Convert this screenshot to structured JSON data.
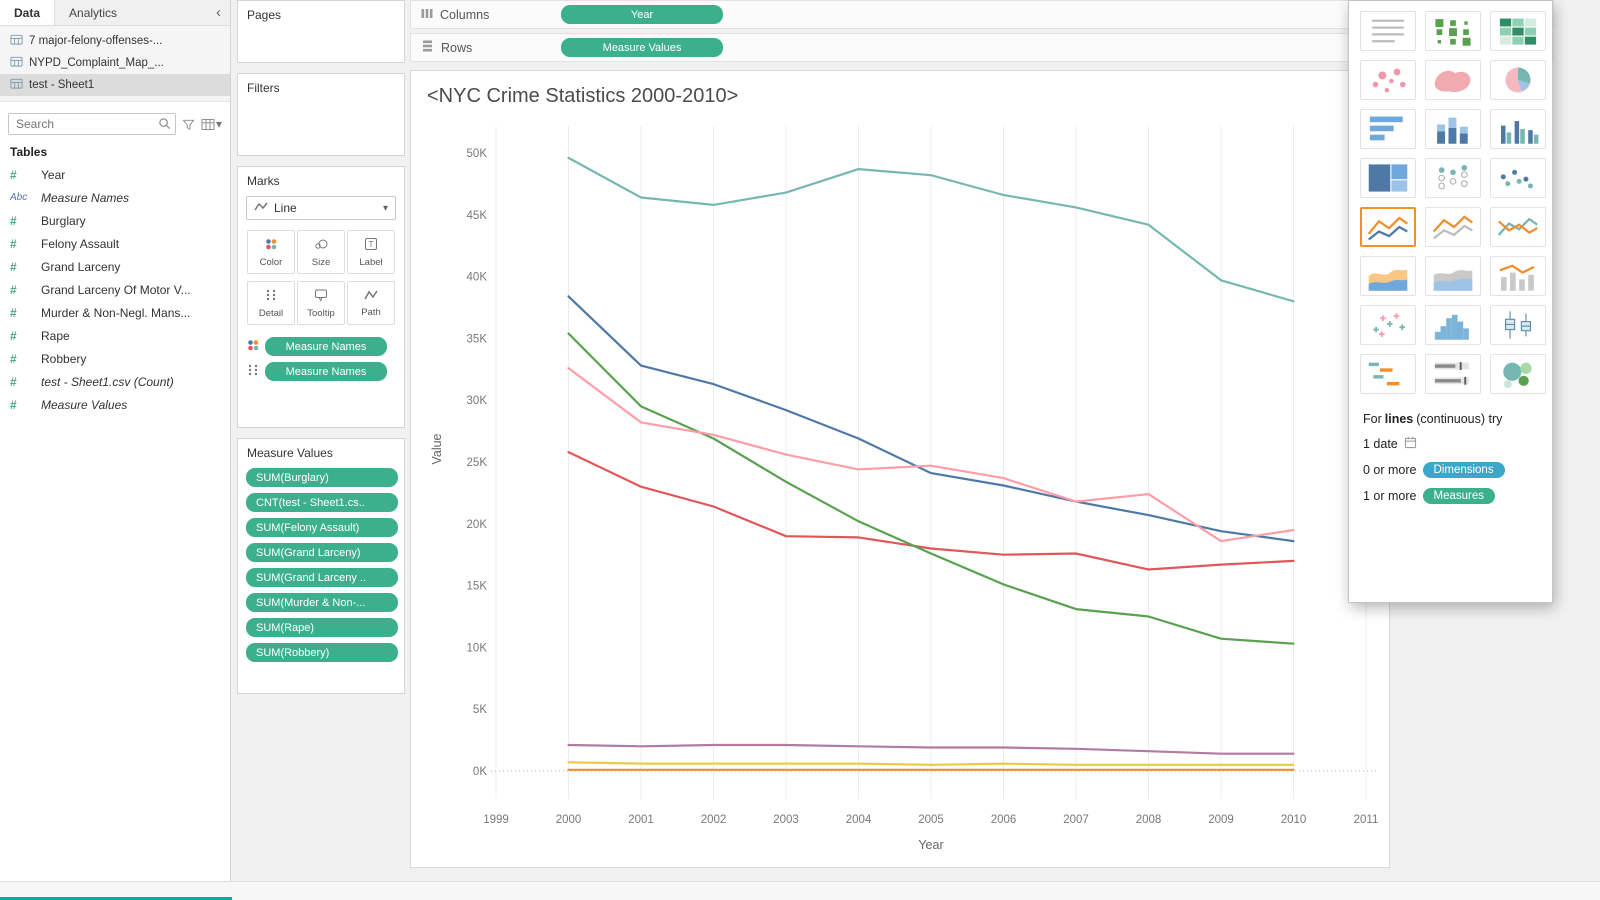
{
  "icons": {
    "collapse_chevron": "‹",
    "dropdown_caret": "▾",
    "search": "magnifier",
    "filter": "funnel",
    "view_data": "grid",
    "calendar": "calendar",
    "columns_shelf": "vertical-bars",
    "rows_shelf": "horizontal-bars"
  },
  "sidebar": {
    "tabs": {
      "data": "Data",
      "analytics": "Analytics"
    },
    "data_sources": [
      {
        "label": "7 major-felony-offenses-...",
        "selected": false
      },
      {
        "label": "NYPD_Complaint_Map_...",
        "selected": false
      },
      {
        "label": "test - Sheet1",
        "selected": true
      }
    ],
    "search": {
      "placeholder": "Search"
    },
    "tables_header": "Tables",
    "fields": [
      {
        "type": "number",
        "label": "Year",
        "italic": false
      },
      {
        "type": "string",
        "label": "Measure Names",
        "italic": true
      },
      {
        "type": "number",
        "label": "Burglary",
        "italic": false
      },
      {
        "type": "number",
        "label": "Felony Assault",
        "italic": false
      },
      {
        "type": "number",
        "label": "Grand Larceny",
        "italic": false
      },
      {
        "type": "number",
        "label": "Grand Larceny Of Motor V...",
        "italic": false
      },
      {
        "type": "number",
        "label": "Murder & Non-Negl. Mans...",
        "italic": false
      },
      {
        "type": "number",
        "label": "Rape",
        "italic": false
      },
      {
        "type": "number",
        "label": "Robbery",
        "italic": false
      },
      {
        "type": "number",
        "label": "test - Sheet1.csv (Count)",
        "italic": true
      },
      {
        "type": "number",
        "label": "Measure Values",
        "italic": true
      }
    ]
  },
  "cards": {
    "pages": {
      "title": "Pages"
    },
    "filters": {
      "title": "Filters"
    },
    "marks": {
      "title": "Marks",
      "mark_type": "Line",
      "buttons_row1": [
        "Color",
        "Size",
        "Label"
      ],
      "buttons_row2": [
        "Detail",
        "Tooltip",
        "Path"
      ],
      "pills": [
        {
          "icon": "color-legend",
          "label": "Measure Names"
        },
        {
          "icon": "detail-legend",
          "label": "Measure Names"
        }
      ]
    },
    "measure_values": {
      "title": "Measure Values",
      "pills": [
        "SUM(Burglary)",
        "CNT(test - Sheet1.cs..",
        "SUM(Felony Assault)",
        "SUM(Grand Larceny)",
        "SUM(Grand Larceny ..",
        "SUM(Murder & Non-...",
        "SUM(Rape)",
        "SUM(Robbery)"
      ]
    }
  },
  "shelves": {
    "columns": {
      "label": "Columns",
      "pills": [
        "Year"
      ]
    },
    "rows": {
      "label": "Rows",
      "pills": [
        "Measure Values"
      ]
    }
  },
  "chart_data": {
    "type": "line",
    "title": "<NYC Crime Statistics 2000-2010>",
    "xlabel": "Year",
    "ylabel": "Value",
    "grid": "vertical",
    "unit": "thousands",
    "x": [
      2000,
      2001,
      2002,
      2003,
      2004,
      2005,
      2006,
      2007,
      2008,
      2009,
      2010
    ],
    "x_axis_ticks": [
      1999,
      2000,
      2001,
      2002,
      2003,
      2004,
      2005,
      2006,
      2007,
      2008,
      2009,
      2010,
      2011
    ],
    "y_tick_labels": [
      "0K",
      "5K",
      "10K",
      "15K",
      "20K",
      "25K",
      "30K",
      "35K",
      "40K",
      "45K",
      "50K"
    ],
    "y_tick_values_k": [
      0,
      5,
      10,
      15,
      20,
      25,
      30,
      35,
      40,
      45,
      50
    ],
    "ylim_k": [
      -2.2,
      52.2
    ],
    "series": [
      {
        "name": "SUM(Burglary)",
        "color": "#4e79a7",
        "values_k": [
          38.4,
          32.8,
          31.3,
          29.2,
          26.9,
          24.1,
          23.1,
          21.8,
          20.7,
          19.4,
          18.6
        ]
      },
      {
        "name": "CNT(test - Sheet1.csv)",
        "color": "#f28e2b",
        "values_k": [
          0.1,
          0.1,
          0.1,
          0.1,
          0.1,
          0.1,
          0.1,
          0.1,
          0.1,
          0.1,
          0.1
        ]
      },
      {
        "name": "SUM(Felony Assault)",
        "color": "#e15759",
        "values_k": [
          25.8,
          23.0,
          21.4,
          19.0,
          18.9,
          18.0,
          17.5,
          17.6,
          16.3,
          16.7,
          17.0
        ]
      },
      {
        "name": "SUM(Grand Larceny)",
        "color": "#76b7b2",
        "values_k": [
          49.6,
          46.4,
          45.8,
          46.8,
          48.7,
          48.2,
          46.6,
          45.6,
          44.2,
          39.7,
          38.0
        ]
      },
      {
        "name": "SUM(Grand Larceny Of Motor Vehicle)",
        "color": "#59a14f",
        "values_k": [
          35.4,
          29.5,
          26.9,
          23.4,
          20.2,
          17.6,
          15.1,
          13.1,
          12.5,
          10.7,
          10.3
        ]
      },
      {
        "name": "SUM(Murder & Non-Negl. Manslaughter)",
        "color": "#edc948",
        "values_k": [
          0.7,
          0.6,
          0.6,
          0.6,
          0.6,
          0.5,
          0.6,
          0.5,
          0.5,
          0.5,
          0.5
        ]
      },
      {
        "name": "SUM(Rape)",
        "color": "#b07aa1",
        "values_k": [
          2.1,
          2.0,
          2.1,
          2.1,
          2.0,
          1.9,
          1.9,
          1.8,
          1.6,
          1.4,
          1.4
        ]
      },
      {
        "name": "SUM(Robbery)",
        "color": "#ff9da7",
        "values_k": [
          32.6,
          28.2,
          27.2,
          25.6,
          24.4,
          24.7,
          23.7,
          21.8,
          22.4,
          18.6,
          19.5
        ]
      }
    ]
  },
  "show_me": {
    "thumbnails": [
      {
        "name": "text-table",
        "selected": false
      },
      {
        "name": "heat-map",
        "selected": false
      },
      {
        "name": "highlight-table",
        "selected": false
      },
      {
        "name": "symbol-map",
        "selected": false
      },
      {
        "name": "filled-map",
        "selected": false
      },
      {
        "name": "pie-chart",
        "selected": false
      },
      {
        "name": "horizontal-bar",
        "selected": false
      },
      {
        "name": "stacked-bar",
        "selected": false
      },
      {
        "name": "side-by-side-bar",
        "selected": false
      },
      {
        "name": "treemap",
        "selected": false
      },
      {
        "name": "circle-view",
        "selected": false
      },
      {
        "name": "side-by-side-circle",
        "selected": false
      },
      {
        "name": "line-continuous",
        "selected": true
      },
      {
        "name": "line-discrete",
        "selected": false
      },
      {
        "name": "dual-line",
        "selected": false
      },
      {
        "name": "area-continuous",
        "selected": false
      },
      {
        "name": "area-discrete",
        "selected": false
      },
      {
        "name": "dual-combination",
        "selected": false
      },
      {
        "name": "scatter-plot",
        "selected": false
      },
      {
        "name": "histogram",
        "selected": false
      },
      {
        "name": "box-and-whisker",
        "selected": false
      },
      {
        "name": "gantt",
        "selected": false
      },
      {
        "name": "bullet-graph",
        "selected": false
      },
      {
        "name": "packed-bubbles",
        "selected": false
      }
    ],
    "footer": {
      "line1_pre": "For",
      "line1_bold": "lines",
      "line1_post": "(continuous) try",
      "req_date": "1 date",
      "req_dims": "0 or more",
      "dims_pill": "Dimensions",
      "req_meas": "1 or more",
      "meas_pill": "Measures"
    }
  }
}
